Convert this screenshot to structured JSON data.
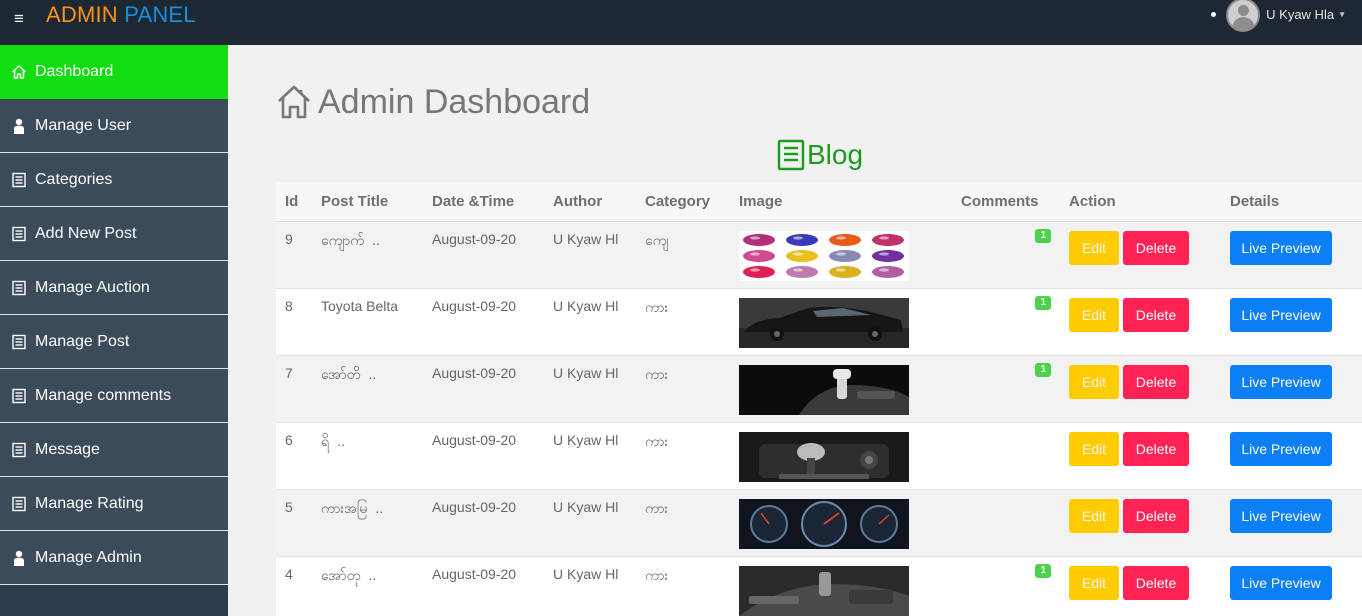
{
  "header": {
    "brand_part1": "ADMIN",
    "brand_part2": "PANEL",
    "user_name": "U Kyaw Hla"
  },
  "sidebar": {
    "items": [
      {
        "label": "Dashboard",
        "icon": "home-icon",
        "active": true
      },
      {
        "label": "Manage User",
        "icon": "user-icon"
      },
      {
        "label": "Categories",
        "icon": "list-icon"
      },
      {
        "label": "Add New Post",
        "icon": "list-icon"
      },
      {
        "label": "Manage Auction",
        "icon": "list-icon"
      },
      {
        "label": "Manage Post",
        "icon": "list-icon"
      },
      {
        "label": "Manage comments",
        "icon": "list-icon"
      },
      {
        "label": "Message",
        "icon": "list-icon"
      },
      {
        "label": "Manage Rating",
        "icon": "list-icon"
      },
      {
        "label": "Manage Admin",
        "icon": "user-icon"
      }
    ]
  },
  "main": {
    "title": "Admin Dashboard",
    "section_title": "Blog",
    "columns": [
      "Id",
      "Post Title",
      "Date &Time",
      "Author",
      "Category",
      "Image",
      "Comments",
      "Action",
      "Details"
    ],
    "buttons": {
      "edit": "Edit",
      "delete": "Delete",
      "preview": "Live Preview"
    },
    "rows": [
      {
        "id": "9",
        "title": "ကျောက်�..",
        "date": "August-09-20",
        "author": "U Kyaw Hl",
        "category": "ကျေ�",
        "comments": "1",
        "image": "gems"
      },
      {
        "id": "8",
        "title": "Toyota Belta",
        "date": "August-09-20",
        "author": "U Kyaw Hl",
        "category": "ကား",
        "comments": "1",
        "image": "car-side"
      },
      {
        "id": "7",
        "title": "အော်တိ�..",
        "date": "August-09-20",
        "author": "U Kyaw Hl",
        "category": "ကား",
        "comments": "1",
        "image": "gear-shift-auto"
      },
      {
        "id": "6",
        "title": "ရိ�..",
        "date": "August-09-20",
        "author": "U Kyaw Hl",
        "category": "ကား",
        "comments": "",
        "image": "gear-shift-manual"
      },
      {
        "id": "5",
        "title": "ကားအမြ�..",
        "date": "August-09-20",
        "author": "U Kyaw Hl",
        "category": "ကား",
        "comments": "",
        "image": "dashboard-gauges"
      },
      {
        "id": "4",
        "title": "အော်တု�..",
        "date": "August-09-20",
        "author": "U Kyaw Hl",
        "category": "ကား",
        "comments": "1",
        "image": "car-interior"
      }
    ]
  }
}
